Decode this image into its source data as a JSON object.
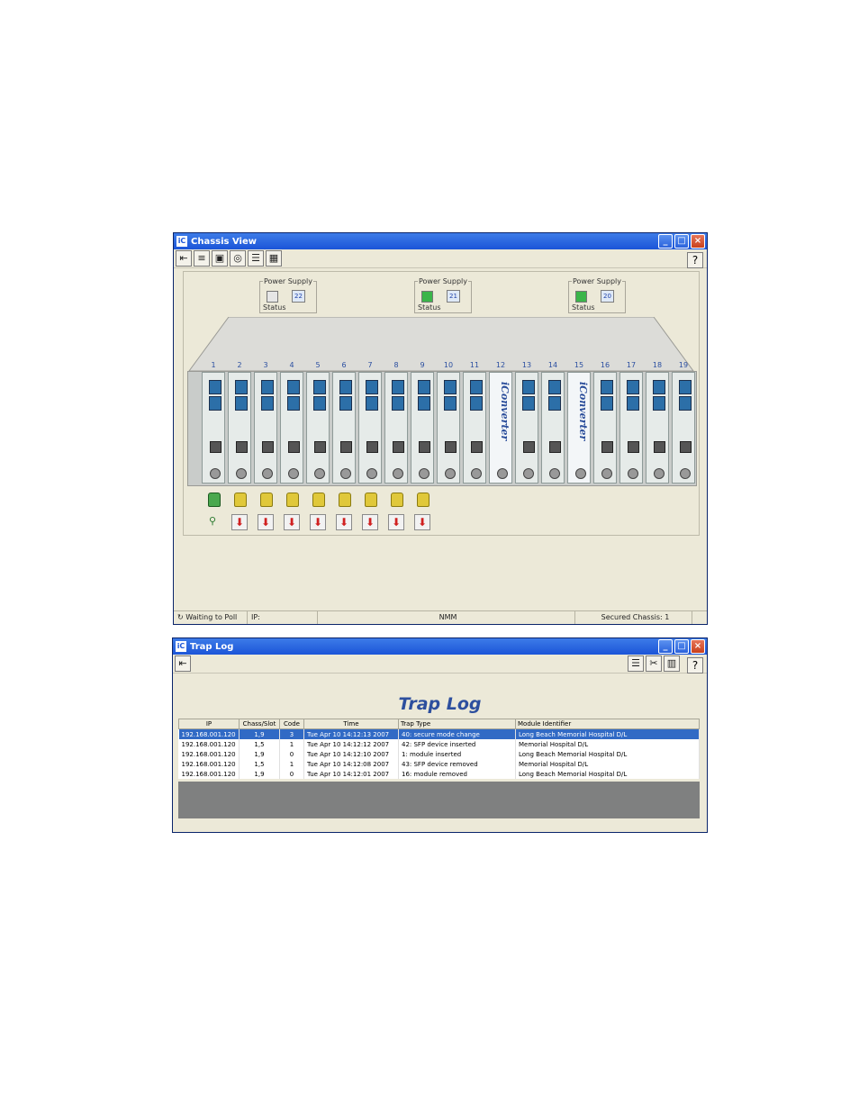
{
  "chassis_window": {
    "title": "Chassis View",
    "power_supplies": [
      {
        "label": "Power Supply",
        "number": "22",
        "status_label": "Status",
        "status_color": "#e6e6e6"
      },
      {
        "label": "Power Supply",
        "number": "21",
        "status_label": "Status",
        "status_color": "#3bb54a"
      },
      {
        "label": "Power Supply",
        "number": "20",
        "status_label": "Status",
        "status_color": "#3bb54a"
      }
    ],
    "slots": [
      "1",
      "2",
      "3",
      "4",
      "5",
      "6",
      "7",
      "8",
      "9",
      "10",
      "11",
      "12",
      "13",
      "14",
      "15",
      "16",
      "17",
      "18",
      "19"
    ],
    "brand_text": "iConverter",
    "status_bar": {
      "poll": "Waiting to Poll",
      "ip": "IP:",
      "mode": "NMM",
      "secured": "Secured Chassis: 1"
    }
  },
  "trap_window": {
    "title": "Trap Log",
    "heading": "Trap Log",
    "columns": [
      "IP",
      "Chass/Slot",
      "Code",
      "Time",
      "Trap Type",
      "Module Identifier"
    ],
    "rows": [
      [
        "192.168.001.120",
        "1,9",
        "3",
        "Tue Apr 10 14:12:13 2007",
        "40: secure mode change",
        "Long Beach Memorial Hospital D/L"
      ],
      [
        "192.168.001.120",
        "1,5",
        "1",
        "Tue Apr 10 14:12:12 2007",
        "42: SFP device inserted",
        "Memorial Hospital D/L"
      ],
      [
        "192.168.001.120",
        "1,9",
        "0",
        "Tue Apr 10 14:12:10 2007",
        "1: module inserted",
        "Long Beach Memorial Hospital D/L"
      ],
      [
        "192.168.001.120",
        "1,5",
        "1",
        "Tue Apr 10 14:12:08 2007",
        "43: SFP device removed",
        "Memorial Hospital D/L"
      ],
      [
        "192.168.001.120",
        "1,9",
        "0",
        "Tue Apr 10 14:12:01 2007",
        "16: module removed",
        "Long Beach Memorial Hospital D/L"
      ]
    ]
  },
  "icons": {
    "exit": "exit-icon",
    "help": "help-icon",
    "lock": "lock-icon",
    "remove": "red-down-arrow-icon"
  }
}
